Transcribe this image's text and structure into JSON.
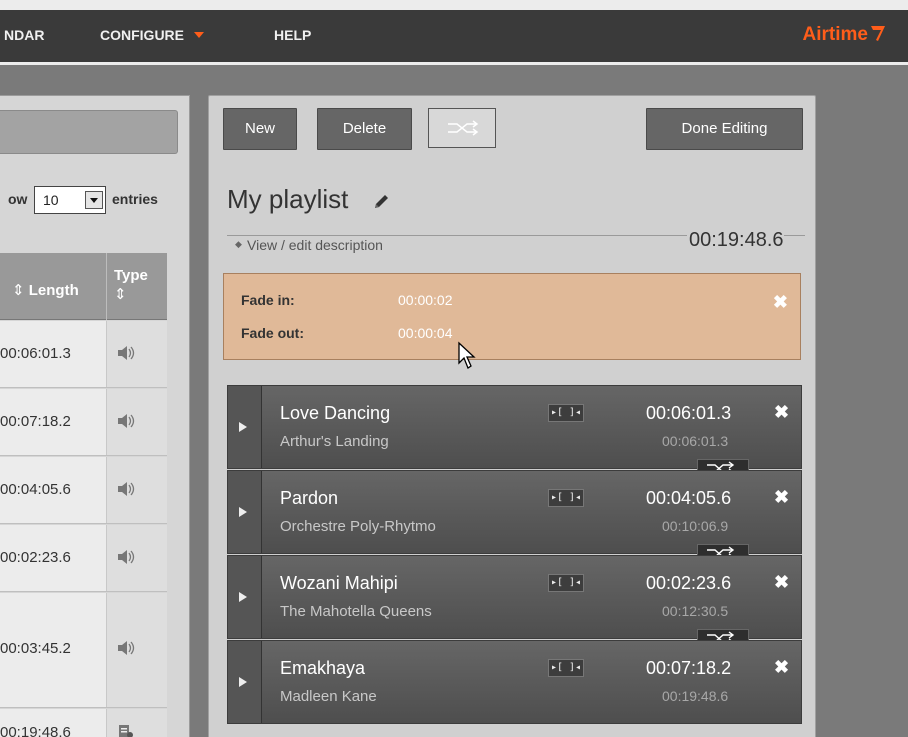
{
  "nav": {
    "items": [
      {
        "label": "NDAR"
      },
      {
        "label": "CONFIGURE"
      },
      {
        "label": "HELP"
      }
    ],
    "logo": "Airtime",
    "accent": "#ff5d1a"
  },
  "library": {
    "show_label": "ow",
    "page_size": "10",
    "entries_label": "entries",
    "columns": {
      "length": "Length",
      "type": "Type"
    },
    "rows": [
      {
        "length": "00:06:01.3",
        "type_icon": "audio-icon"
      },
      {
        "length": "00:07:18.2",
        "type_icon": "audio-icon"
      },
      {
        "length": "00:04:05.6",
        "type_icon": "audio-icon"
      },
      {
        "length": "00:02:23.6",
        "type_icon": "audio-icon"
      },
      {
        "length": "00:03:45.2",
        "type_icon": "audio-icon"
      },
      {
        "length": "00:19:48.6",
        "type_icon": "playlist-icon"
      }
    ]
  },
  "playlist": {
    "buttons": {
      "new": "New",
      "delete": "Delete",
      "done": "Done Editing"
    },
    "title": "My playlist",
    "description_toggle": "View / edit description",
    "total_length": "00:19:48.6",
    "fade": {
      "fade_in_label": "Fade in:",
      "fade_in_value": "00:00:02",
      "fade_out_label": "Fade out:",
      "fade_out_value": "00:00:04"
    },
    "tracks": [
      {
        "title": "Love Dancing",
        "artist": "Arthur's Landing",
        "length": "00:06:01.3",
        "cumulative": "00:06:01.3"
      },
      {
        "title": "Pardon",
        "artist": "Orchestre Poly-Rhytmo",
        "length": "00:04:05.6",
        "cumulative": "00:10:06.9"
      },
      {
        "title": "Wozani Mahipi",
        "artist": "The Mahotella Queens",
        "length": "00:02:23.6",
        "cumulative": "00:12:30.5"
      },
      {
        "title": "Emakhaya",
        "artist": "Madleen Kane",
        "length": "00:07:18.2",
        "cumulative": "00:19:48.6"
      }
    ],
    "cue_label": "▸[ ]◂"
  }
}
